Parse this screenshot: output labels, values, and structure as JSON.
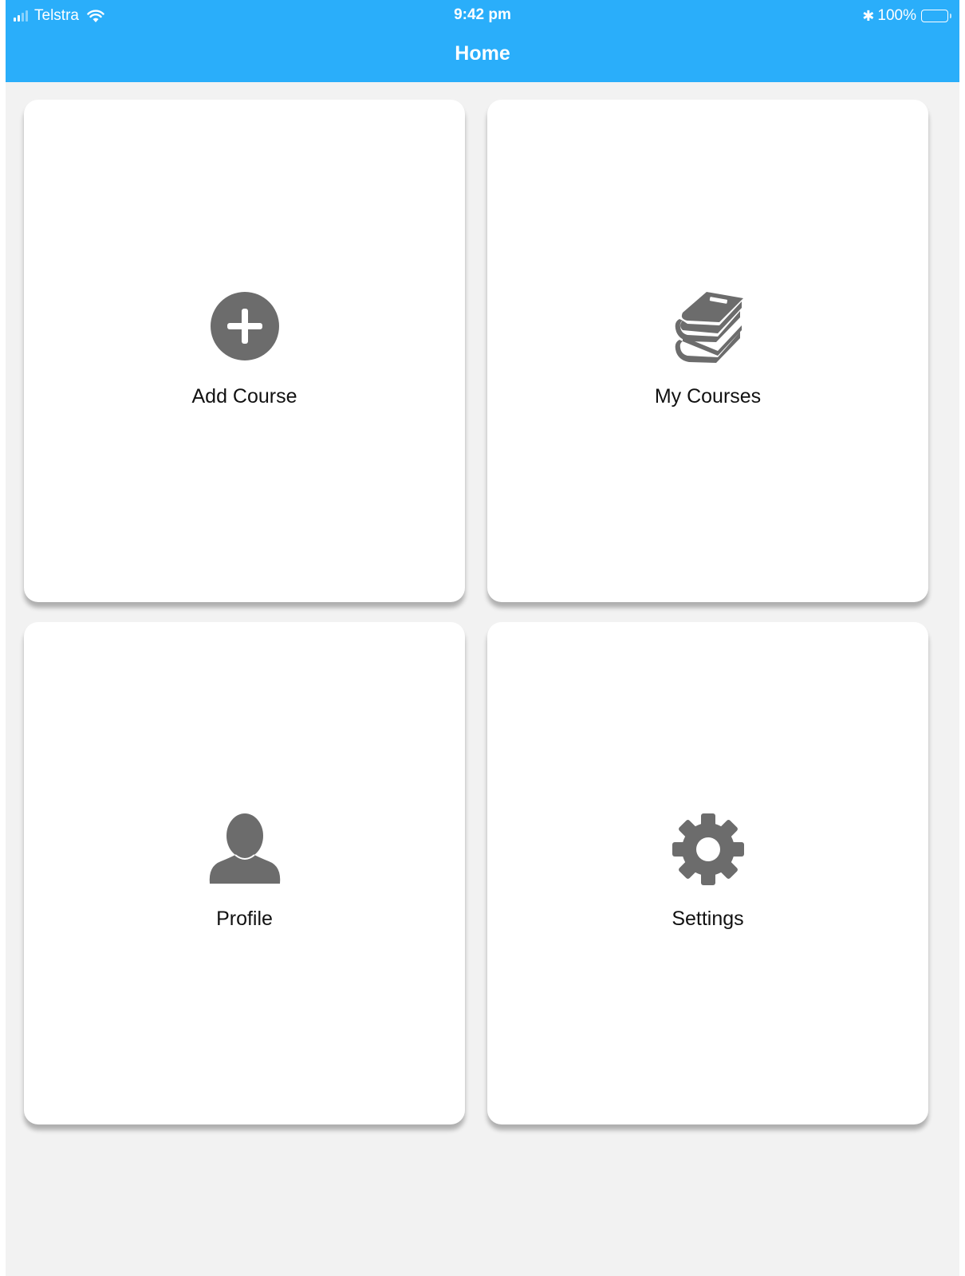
{
  "status_bar": {
    "carrier": "Telstra",
    "time": "9:42 pm",
    "battery": "100%",
    "signal_icon": "signal-bars-icon",
    "wifi_icon": "wifi-icon",
    "bluetooth_icon": "bluetooth-icon",
    "battery_icon": "battery-icon"
  },
  "nav": {
    "title": "Home"
  },
  "tiles": [
    {
      "label": "Add Course",
      "icon": "add-circle-icon"
    },
    {
      "label": "My Courses",
      "icon": "books-icon"
    },
    {
      "label": "Profile",
      "icon": "user-icon"
    },
    {
      "label": "Settings",
      "icon": "gear-icon"
    }
  ],
  "colors": {
    "accent": "#2aaefa",
    "background": "#f2f2f2",
    "tile": "#ffffff",
    "icon": "#6c6c6c",
    "label": "#111111"
  }
}
